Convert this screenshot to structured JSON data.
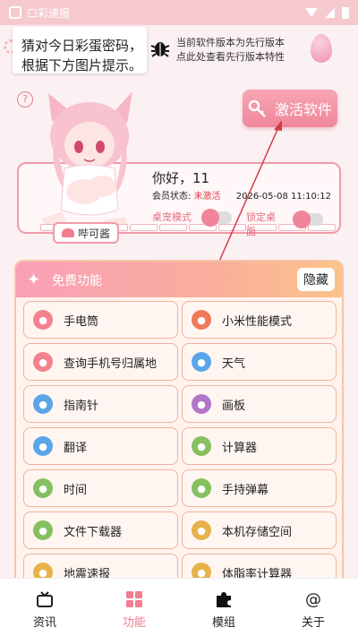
{
  "statusbar": {
    "title": "口彩速报"
  },
  "hint": {
    "line1": "猜对今日彩蛋密码，",
    "line2": "根据下方图片提示。"
  },
  "version": {
    "line1": "当前软件版本为先行版本",
    "line2": "点此处查看先行版本特性"
  },
  "help": {
    "label": "?"
  },
  "activate": {
    "label": "激活软件"
  },
  "profile": {
    "greeting": "你好，11",
    "status_label": "会员状态:",
    "status_value": "未激活",
    "datetime": "2026-05-08 11:10:12",
    "toggle1_label": "桌宠模式",
    "toggle2_label": "锁定桌",
    "toggle2_sub": "面",
    "name_tag": "哔可酱"
  },
  "panel": {
    "title": "免费功能",
    "hide_label": "隐藏",
    "items": [
      {
        "label": "手电筒",
        "icon": "flashlight-icon",
        "color": "#f2828e"
      },
      {
        "label": "小米性能模式",
        "icon": "performance-icon",
        "color": "#ef7a5a"
      },
      {
        "label": "查询手机号归属地",
        "icon": "phone-location-icon",
        "color": "#f2828e"
      },
      {
        "label": "天气",
        "icon": "weather-icon",
        "color": "#5aa6e8"
      },
      {
        "label": "指南针",
        "icon": "compass-icon",
        "color": "#5aa6e8"
      },
      {
        "label": "画板",
        "icon": "drawing-board-icon",
        "color": "#b276c8"
      },
      {
        "label": "翻译",
        "icon": "translate-icon",
        "color": "#5aa6e8"
      },
      {
        "label": "计算器",
        "icon": "calculator-icon",
        "color": "#86c060"
      },
      {
        "label": "时间",
        "icon": "clock-icon",
        "color": "#86c060"
      },
      {
        "label": "手持弹幕",
        "icon": "barrage-icon",
        "color": "#86c060"
      },
      {
        "label": "文件下载器",
        "icon": "download-icon",
        "color": "#86c060"
      },
      {
        "label": "本机存储空间",
        "icon": "storage-icon",
        "color": "#e8b24a"
      },
      {
        "label": "地震速报",
        "icon": "earthquake-icon",
        "color": "#e8b24a"
      },
      {
        "label": "体脂率计算器",
        "icon": "body-fat-icon",
        "color": "#e8b24a"
      }
    ]
  },
  "tabs": [
    {
      "label": "资讯",
      "icon": "news-icon"
    },
    {
      "label": "功能",
      "icon": "grid-icon"
    },
    {
      "label": "模组",
      "icon": "puzzle-icon"
    },
    {
      "label": "关于",
      "icon": "at-icon"
    }
  ],
  "colors": {
    "accent": "#f27c90",
    "activate": "#f0879b",
    "inactive": "#e23b4a"
  }
}
